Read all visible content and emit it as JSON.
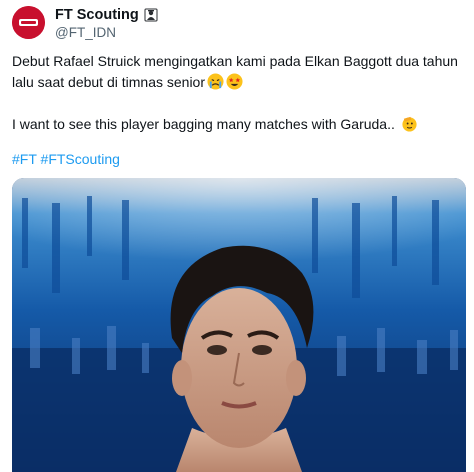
{
  "author": {
    "display_name": "FT Scouting",
    "handle": "@FT_IDN",
    "avatar_icon": "ft-logo-avatar",
    "badge_icon": "affiliated-org-badge-icon"
  },
  "tweet": {
    "line1": "Debut Rafael Struick mengingatkan kami pada Elkan Baggott dua tahun",
    "line2": "lalu saat debut di timnas senior",
    "line3": "I want to see this player bagging many matches with Garuda..",
    "hashtags": [
      "#FT",
      "#FTScouting"
    ],
    "emojis": [
      "crying-face",
      "star-struck",
      "saluting-face"
    ]
  },
  "media": {
    "description_icon": "player-portrait-photo"
  },
  "colors": {
    "link": "#1d9bf0",
    "text": "#0f1419",
    "muted": "#536471",
    "brand": "#c8102e",
    "photo_bg": "#0f3a78"
  }
}
